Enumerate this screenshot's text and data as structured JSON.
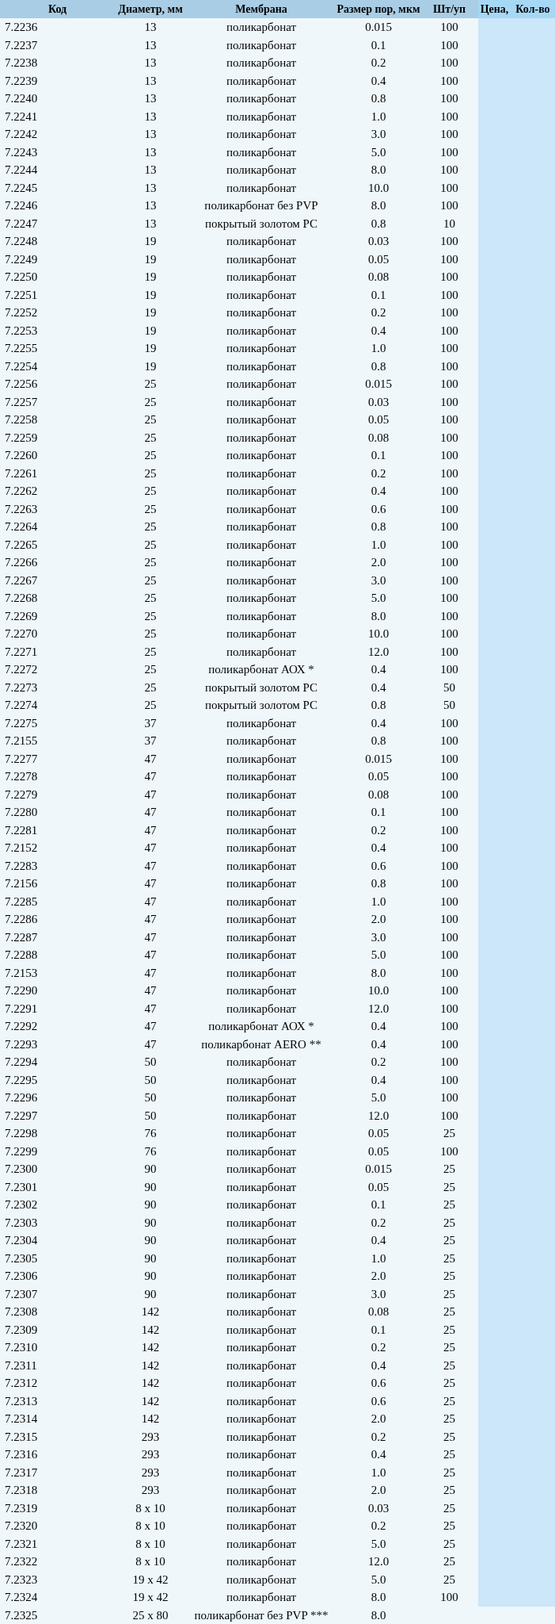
{
  "columns": [
    "Код",
    "Диаметр, мм",
    "Мембрана",
    "Размер пор, мкм",
    "Шт/уп",
    "Цена,",
    "Кол-во"
  ],
  "rows": [
    {
      "cells": [
        "7.2236",
        "13",
        "поликарбонат",
        "0.015",
        "100"
      ]
    },
    {
      "cells": [
        "7.2237",
        "13",
        "поликарбонат",
        "0.1",
        "100"
      ]
    },
    {
      "cells": [
        "7.2238",
        "13",
        "поликарбонат",
        "0.2",
        "100"
      ]
    },
    {
      "cells": [
        "7.2239",
        "13",
        "поликарбонат",
        "0.4",
        "100"
      ]
    },
    {
      "cells": [
        "7.2240",
        "13",
        "поликарбонат",
        "0.8",
        "100"
      ]
    },
    {
      "cells": [
        "7.2241",
        "13",
        "поликарбонат",
        "1.0",
        "100"
      ]
    },
    {
      "cells": [
        "7.2242",
        "13",
        "поликарбонат",
        "3.0",
        "100"
      ]
    },
    {
      "cells": [
        "7.2243",
        "13",
        "поликарбонат",
        "5.0",
        "100"
      ]
    },
    {
      "cells": [
        "7.2244",
        "13",
        "поликарбонат",
        "8.0",
        "100"
      ]
    },
    {
      "cells": [
        "7.2245",
        "13",
        "поликарбонат",
        "10.0",
        "100"
      ]
    },
    {
      "cells": [
        "7.2246",
        "13",
        "поликарбонат без PVP",
        "8.0",
        "100"
      ]
    },
    {
      "cells": [
        "7.2247",
        "13",
        "покрытый золотом PC",
        "0.8",
        "10"
      ]
    },
    {
      "cells": [
        "7.2248",
        "19",
        "поликарбонат",
        "0.03",
        "100"
      ]
    },
    {
      "cells": [
        "7.2249",
        "19",
        "поликарбонат",
        "0.05",
        "100"
      ]
    },
    {
      "cells": [
        "7.2250",
        "19",
        "поликарбонат",
        "0.08",
        "100"
      ]
    },
    {
      "cells": [
        "7.2251",
        "19",
        "поликарбонат",
        "0.1",
        "100"
      ]
    },
    {
      "cells": [
        "7.2252",
        "19",
        "поликарбонат",
        "0.2",
        "100"
      ]
    },
    {
      "cells": [
        "7.2253",
        "19",
        "поликарбонат",
        "0.4",
        "100"
      ]
    },
    {
      "cells": [
        "7.2255",
        "19",
        "поликарбонат",
        "1.0",
        "100"
      ]
    },
    {
      "cells": [
        "7.2254",
        "19",
        "поликарбонат",
        "0.8",
        "100"
      ]
    },
    {
      "cells": [
        "7.2256",
        "25",
        "поликарбонат",
        "0.015",
        "100"
      ]
    },
    {
      "cells": [
        "7.2257",
        "25",
        "поликарбонат",
        "0.03",
        "100"
      ]
    },
    {
      "cells": [
        "7.2258",
        "25",
        "поликарбонат",
        "0.05",
        "100"
      ]
    },
    {
      "cells": [
        "7.2259",
        "25",
        "поликарбонат",
        "0.08",
        "100"
      ]
    },
    {
      "cells": [
        "7.2260",
        "25",
        "поликарбонат",
        "0.1",
        "100"
      ]
    },
    {
      "cells": [
        "7.2261",
        "25",
        "поликарбонат",
        "0.2",
        "100"
      ]
    },
    {
      "cells": [
        "7.2262",
        "25",
        "поликарбонат",
        "0.4",
        "100"
      ]
    },
    {
      "cells": [
        "7.2263",
        "25",
        "поликарбонат",
        "0.6",
        "100"
      ]
    },
    {
      "cells": [
        "7.2264",
        "25",
        "поликарбонат",
        "0.8",
        "100"
      ]
    },
    {
      "cells": [
        "7.2265",
        "25",
        "поликарбонат",
        "1.0",
        "100"
      ]
    },
    {
      "cells": [
        "7.2266",
        "25",
        "поликарбонат",
        "2.0",
        "100"
      ]
    },
    {
      "cells": [
        "7.2267",
        "25",
        "поликарбонат",
        "3.0",
        "100"
      ]
    },
    {
      "cells": [
        "7.2268",
        "25",
        "поликарбонат",
        "5.0",
        "100"
      ]
    },
    {
      "cells": [
        "7.2269",
        "25",
        "поликарбонат",
        "8.0",
        "100"
      ]
    },
    {
      "cells": [
        "7.2270",
        "25",
        "поликарбонат",
        "10.0",
        "100"
      ]
    },
    {
      "cells": [
        "7.2271",
        "25",
        "поликарбонат",
        "12.0",
        "100"
      ]
    },
    {
      "cells": [
        "7.2272",
        "25",
        "поликарбонат АОХ *",
        "0.4",
        "100"
      ]
    },
    {
      "cells": [
        "7.2273",
        "25",
        "покрытый золотом PC",
        "0.4",
        "50"
      ]
    },
    {
      "cells": [
        "7.2274",
        "25",
        "покрытый золотом PC",
        "0.8",
        "50"
      ]
    },
    {
      "cells": [
        "7.2275",
        "37",
        "поликарбонат",
        "0.4",
        "100"
      ]
    },
    {
      "cells": [
        "7.2155",
        "37",
        "поликарбонат",
        "0.8",
        "100"
      ]
    },
    {
      "cells": [
        "7.2277",
        "47",
        "поликарбонат",
        "0.015",
        "100"
      ]
    },
    {
      "cells": [
        "7.2278",
        "47",
        "поликарбонат",
        "0.05",
        "100"
      ]
    },
    {
      "cells": [
        "7.2279",
        "47",
        "поликарбонат",
        "0.08",
        "100"
      ]
    },
    {
      "cells": [
        "7.2280",
        "47",
        "поликарбонат",
        "0.1",
        "100"
      ]
    },
    {
      "cells": [
        "7.2281",
        "47",
        "поликарбонат",
        "0.2",
        "100"
      ]
    },
    {
      "cells": [
        "7.2152",
        "47",
        "поликарбонат",
        "0.4",
        "100"
      ]
    },
    {
      "cells": [
        "7.2283",
        "47",
        "поликарбонат",
        "0.6",
        "100"
      ]
    },
    {
      "cells": [
        "7.2156",
        "47",
        "поликарбонат",
        "0.8",
        "100"
      ]
    },
    {
      "cells": [
        "7.2285",
        "47",
        "поликарбонат",
        "1.0",
        "100"
      ]
    },
    {
      "cells": [
        "7.2286",
        "47",
        "поликарбонат",
        "2.0",
        "100"
      ]
    },
    {
      "cells": [
        "7.2287",
        "47",
        "поликарбонат",
        "3.0",
        "100"
      ]
    },
    {
      "cells": [
        "7.2288",
        "47",
        "поликарбонат",
        "5.0",
        "100"
      ]
    },
    {
      "cells": [
        "7.2153",
        "47",
        "поликарбонат",
        "8.0",
        "100"
      ]
    },
    {
      "cells": [
        "7.2290",
        "47",
        "поликарбонат",
        "10.0",
        "100"
      ]
    },
    {
      "cells": [
        "7.2291",
        "47",
        "поликарбонат",
        "12.0",
        "100"
      ]
    },
    {
      "cells": [
        "7.2292",
        "47",
        "поликарбонат АОХ *",
        "0.4",
        "100"
      ]
    },
    {
      "cells": [
        "7.2293",
        "47",
        "поликарбонат AERO **",
        "0.4",
        "100"
      ]
    },
    {
      "cells": [
        "7.2294",
        "50",
        "поликарбонат",
        "0.2",
        "100"
      ]
    },
    {
      "cells": [
        "7.2295",
        "50",
        "поликарбонат",
        "0.4",
        "100"
      ]
    },
    {
      "cells": [
        "7.2296",
        "50",
        "поликарбонат",
        "5.0",
        "100"
      ]
    },
    {
      "cells": [
        "7.2297",
        "50",
        "поликарбонат",
        "12.0",
        "100"
      ]
    },
    {
      "cells": [
        "7.2298",
        "76",
        "поликарбонат",
        "0.05",
        "25"
      ]
    },
    {
      "cells": [
        "7.2299",
        "76",
        "поликарбонат",
        "0.05",
        "100"
      ]
    },
    {
      "cells": [
        "7.2300",
        "90",
        "поликарбонат",
        "0.015",
        "25"
      ]
    },
    {
      "cells": [
        "7.2301",
        "90",
        "поликарбонат",
        "0.05",
        "25"
      ]
    },
    {
      "cells": [
        "7.2302",
        "90",
        "поликарбонат",
        "0.1",
        "25"
      ]
    },
    {
      "cells": [
        "7.2303",
        "90",
        "поликарбонат",
        "0.2",
        "25"
      ]
    },
    {
      "cells": [
        "7.2304",
        "90",
        "поликарбонат",
        "0.4",
        "25"
      ]
    },
    {
      "cells": [
        "7.2305",
        "90",
        "поликарбонат",
        "1.0",
        "25"
      ]
    },
    {
      "cells": [
        "7.2306",
        "90",
        "поликарбонат",
        "2.0",
        "25"
      ]
    },
    {
      "cells": [
        "7.2307",
        "90",
        "поликарбонат",
        "3.0",
        "25"
      ]
    },
    {
      "cells": [
        "7.2308",
        "142",
        "поликарбонат",
        "0.08",
        "25"
      ]
    },
    {
      "cells": [
        "7.2309",
        "142",
        "поликарбонат",
        "0.1",
        "25"
      ]
    },
    {
      "cells": [
        "7.2310",
        "142",
        "поликарбонат",
        "0.2",
        "25"
      ]
    },
    {
      "cells": [
        "7.2311",
        "142",
        "поликарбонат",
        "0.4",
        "25"
      ]
    },
    {
      "cells": [
        "7.2312",
        "142",
        "поликарбонат",
        "0.6",
        "25"
      ]
    },
    {
      "cells": [
        "7.2313",
        "142",
        "поликарбонат",
        "0.6",
        "25"
      ]
    },
    {
      "cells": [
        "7.2314",
        "142",
        "поликарбонат",
        "2.0",
        "25"
      ]
    },
    {
      "cells": [
        "7.2315",
        "293",
        "поликарбонат",
        "0.2",
        "25"
      ]
    },
    {
      "cells": [
        "7.2316",
        "293",
        "поликарбонат",
        "0.4",
        "25"
      ]
    },
    {
      "cells": [
        "7.2317",
        "293",
        "поликарбонат",
        "1.0",
        "25"
      ]
    },
    {
      "cells": [
        "7.2318",
        "293",
        "поликарбонат",
        "2.0",
        "25"
      ]
    },
    {
      "cells": [
        "7.2319",
        "8 x 10",
        "поликарбонат",
        "0.03",
        "25"
      ]
    },
    {
      "cells": [
        "7.2320",
        "8 x 10",
        "поликарбонат",
        "0.2",
        "25"
      ]
    },
    {
      "cells": [
        "7.2321",
        "8 x 10",
        "поликарбонат",
        "5.0",
        "25"
      ]
    },
    {
      "cells": [
        "7.2322",
        "8 x 10",
        "поликарбонат",
        "12.0",
        "25"
      ]
    },
    {
      "cells": [
        "7.2323",
        "19 x 42",
        "поликарбонат",
        "5.0",
        "25"
      ]
    },
    {
      "cells": [
        "7.2324",
        "19 x 42",
        "поликарбонат",
        "8.0",
        "100"
      ]
    },
    {
      "cells": [
        "7.2325",
        "25 x 80",
        "поликарбонат без PVP ***",
        "8.0"
      ]
    }
  ]
}
